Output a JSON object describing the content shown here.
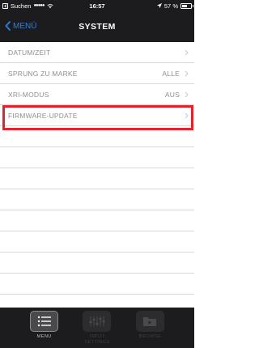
{
  "status_bar": {
    "carrier": "Suchen",
    "signal": "●●●●●",
    "time": "16:57",
    "battery": "57 %",
    "battery_level": 0.57
  },
  "nav": {
    "back_label": "MENÜ",
    "title": "SYSTEM"
  },
  "settings": {
    "rows": [
      {
        "label": "DATUM/ZEIT",
        "value": ""
      },
      {
        "label": "SPRUNG ZU MARKE",
        "value": "ALLE"
      },
      {
        "label": "XRI-MODUS",
        "value": "AUS"
      },
      {
        "label": "FIRMWARE-UPDATE",
        "value": ""
      }
    ]
  },
  "tabs": [
    {
      "label": "MENU",
      "icon": "menu-list-icon",
      "active": true
    },
    {
      "label": "INPUT SETTINGS",
      "icon": "mixer-sliders-icon",
      "active": false
    },
    {
      "label": "BROWSE",
      "icon": "folder-play-icon",
      "active": false
    }
  ],
  "colors": {
    "accent": "#2f7fe0",
    "highlight": "#e3232b",
    "bar_background": "#1c1c1e",
    "row_text": "#8e8e93"
  }
}
